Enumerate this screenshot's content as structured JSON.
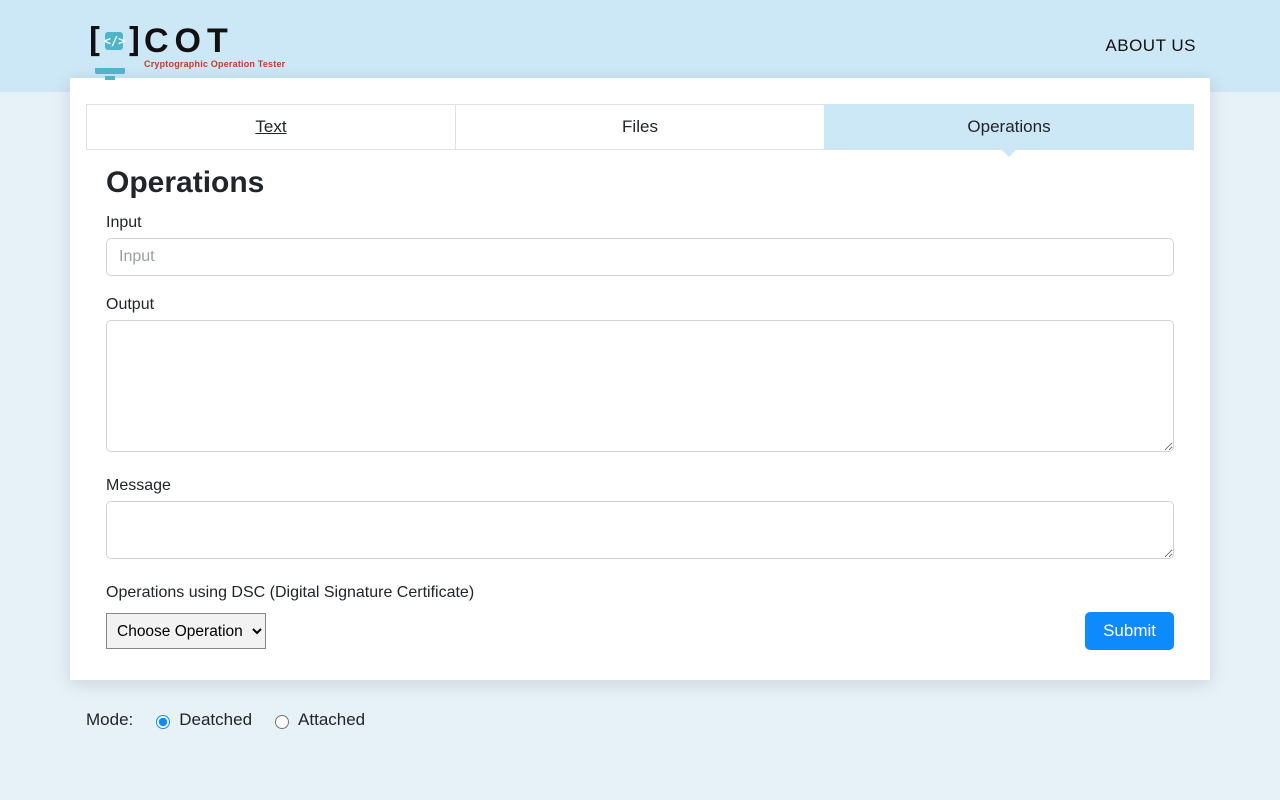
{
  "nav": {
    "about": "ABOUT US"
  },
  "logo": {
    "title": "COT",
    "subtitle": "Cryptographic Operation Tester"
  },
  "tabs": {
    "text": "Text",
    "files": "Files",
    "operations": "Operations"
  },
  "panel": {
    "heading": "Operations",
    "input_label": "Input",
    "input_placeholder": "Input",
    "output_label": "Output",
    "message_label": "Message",
    "dsc_label": "Operations using DSC (Digital Signature Certificate)",
    "select_default": "Choose Operation",
    "submit": "Submit"
  },
  "mode": {
    "label": "Mode:",
    "detached": "Deatched",
    "attached": "Attached",
    "selected": "detached"
  }
}
